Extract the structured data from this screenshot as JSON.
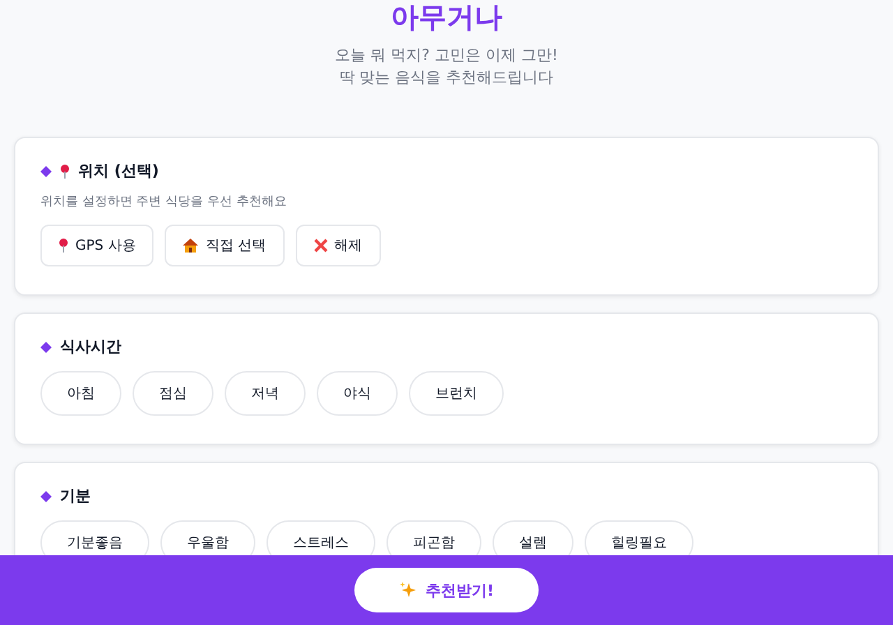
{
  "header": {
    "title": "아무거나",
    "subtitle_lines": [
      "오늘 뭐 먹지? 고민은 이제 그만!",
      "딱 맞는 음식을 추천해드립니다"
    ]
  },
  "sections": [
    {
      "kind": "location",
      "title": "위치 (선택)",
      "description": "위치를 설정하면 주변 식당을 우선 추천해요",
      "buttons": [
        {
          "kind": "gps",
          "label": "GPS 사용"
        },
        {
          "kind": "manual",
          "label": "직접 선택"
        },
        {
          "kind": "clear",
          "label": "해제"
        }
      ]
    },
    {
      "kind": "chips",
      "title": "식사시간",
      "options": [
        {
          "label": "아침",
          "selected": false
        },
        {
          "label": "점심",
          "selected": false
        },
        {
          "label": "저녁",
          "selected": false
        },
        {
          "label": "야식",
          "selected": false
        },
        {
          "label": "브런치",
          "selected": false
        }
      ]
    },
    {
      "kind": "chips",
      "title": "기분",
      "options": [
        {
          "label": "기분좋음",
          "selected": false
        },
        {
          "label": "우울함",
          "selected": false
        },
        {
          "label": "스트레스",
          "selected": false
        },
        {
          "label": "피곤함",
          "selected": false
        },
        {
          "label": "설렘",
          "selected": false
        },
        {
          "label": "힐링필요",
          "selected": false
        }
      ]
    }
  ],
  "footer": {
    "button": "추천받기!"
  }
}
